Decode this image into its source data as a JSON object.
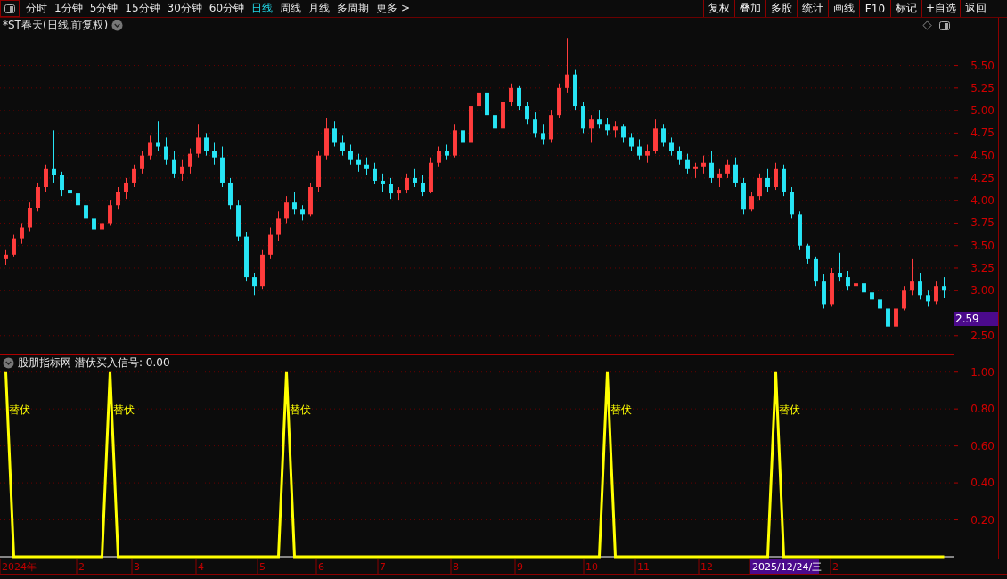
{
  "toolbar": {
    "periods": [
      {
        "label": "分时",
        "selected": false
      },
      {
        "label": "1分钟",
        "selected": false
      },
      {
        "label": "5分钟",
        "selected": false
      },
      {
        "label": "15分钟",
        "selected": false
      },
      {
        "label": "30分钟",
        "selected": false
      },
      {
        "label": "60分钟",
        "selected": false
      },
      {
        "label": "日线",
        "selected": true
      },
      {
        "label": "周线",
        "selected": false
      },
      {
        "label": "月线",
        "selected": false
      },
      {
        "label": "多周期",
        "selected": false
      },
      {
        "label": "更多 >",
        "selected": false
      }
    ],
    "buttons": [
      "复权",
      "叠加",
      "多股",
      "统计",
      "画线",
      "F10",
      "标记",
      "+自选",
      "返回"
    ]
  },
  "price_panel": {
    "title": "*ST春天(日线.前复权)",
    "current_price": "2.59",
    "chart_data": {
      "type": "candlestick",
      "ylim": [
        2.3,
        6.03
      ],
      "grid": true,
      "yticks": [
        {
          "value": 5.5,
          "label": "5.50"
        },
        {
          "value": 5.25,
          "label": "5.25"
        },
        {
          "value": 5,
          "label": "5.00"
        },
        {
          "value": 4.75,
          "label": "4.75"
        },
        {
          "value": 4.5,
          "label": "4.50"
        },
        {
          "value": 4.25,
          "label": "4.25"
        },
        {
          "value": 4,
          "label": "4.00"
        },
        {
          "value": 3.75,
          "label": "3.75"
        },
        {
          "value": 3.5,
          "label": "3.50"
        },
        {
          "value": 3.25,
          "label": "3.25"
        },
        {
          "value": 3,
          "label": "3.00"
        },
        {
          "value": 2.5,
          "label": "2.50"
        }
      ],
      "categories": [
        null,
        null,
        null,
        null,
        null,
        null,
        null,
        null,
        null,
        null,
        null,
        null,
        null,
        null,
        null,
        null,
        null,
        null,
        null,
        null,
        null,
        null,
        null,
        null,
        null,
        null,
        null,
        null,
        null,
        null,
        null,
        null,
        null,
        null,
        null,
        null,
        null,
        null,
        null,
        null,
        null,
        null,
        null,
        null,
        null,
        null,
        null,
        null,
        null,
        null,
        null,
        null,
        null,
        null,
        null,
        null,
        null,
        null,
        null,
        null,
        null,
        null,
        null,
        null,
        null,
        null,
        null,
        null,
        null,
        null,
        null,
        null,
        null,
        null,
        null,
        null,
        null,
        null,
        null,
        null,
        null,
        null,
        null,
        null,
        null,
        null,
        null,
        null,
        null,
        null,
        null,
        null,
        null,
        null,
        null,
        null,
        null,
        null,
        null,
        null,
        null,
        null,
        null,
        null,
        null,
        null,
        null,
        null,
        null,
        null,
        null,
        null,
        null,
        null,
        null,
        null,
        null,
        null
      ],
      "ohlc": [
        [
          3.35,
          3.45,
          3.28,
          3.4
        ],
        [
          3.4,
          3.62,
          3.38,
          3.58
        ],
        [
          3.58,
          3.75,
          3.52,
          3.7
        ],
        [
          3.7,
          3.98,
          3.66,
          3.92
        ],
        [
          3.92,
          4.2,
          3.88,
          4.15
        ],
        [
          4.15,
          4.4,
          4.1,
          4.35
        ],
        [
          4.35,
          4.78,
          4.2,
          4.28
        ],
        [
          4.28,
          4.32,
          4.05,
          4.12
        ],
        [
          4.12,
          4.2,
          4.0,
          4.08
        ],
        [
          4.08,
          4.15,
          3.9,
          3.95
        ],
        [
          3.95,
          4.0,
          3.75,
          3.8
        ],
        [
          3.8,
          3.85,
          3.62,
          3.68
        ],
        [
          3.68,
          3.8,
          3.6,
          3.75
        ],
        [
          3.75,
          4.0,
          3.72,
          3.95
        ],
        [
          3.95,
          4.15,
          3.9,
          4.1
        ],
        [
          4.1,
          4.25,
          4.02,
          4.2
        ],
        [
          4.2,
          4.4,
          4.15,
          4.35
        ],
        [
          4.35,
          4.55,
          4.3,
          4.5
        ],
        [
          4.5,
          4.72,
          4.45,
          4.65
        ],
        [
          4.65,
          4.88,
          4.55,
          4.6
        ],
        [
          4.6,
          4.7,
          4.4,
          4.45
        ],
        [
          4.45,
          4.55,
          4.25,
          4.3
        ],
        [
          4.3,
          4.45,
          4.22,
          4.38
        ],
        [
          4.38,
          4.58,
          4.3,
          4.52
        ],
        [
          4.52,
          4.85,
          4.48,
          4.7
        ],
        [
          4.7,
          4.75,
          4.5,
          4.55
        ],
        [
          4.55,
          4.65,
          4.4,
          4.48
        ],
        [
          4.48,
          4.6,
          4.15,
          4.2
        ],
        [
          4.2,
          4.25,
          3.9,
          3.95
        ],
        [
          3.95,
          4.0,
          3.55,
          3.6
        ],
        [
          3.6,
          3.65,
          3.1,
          3.15
        ],
        [
          3.15,
          3.2,
          2.95,
          3.05
        ],
        [
          3.05,
          3.45,
          3.02,
          3.4
        ],
        [
          3.4,
          3.7,
          3.35,
          3.62
        ],
        [
          3.62,
          3.88,
          3.55,
          3.8
        ],
        [
          3.8,
          4.05,
          3.75,
          3.98
        ],
        [
          3.98,
          4.1,
          3.85,
          3.9
        ],
        [
          3.9,
          3.95,
          3.78,
          3.85
        ],
        [
          3.85,
          4.2,
          3.82,
          4.15
        ],
        [
          4.15,
          4.55,
          4.1,
          4.5
        ],
        [
          4.5,
          4.92,
          4.45,
          4.8
        ],
        [
          4.8,
          4.88,
          4.6,
          4.65
        ],
        [
          4.65,
          4.72,
          4.5,
          4.55
        ],
        [
          4.55,
          4.62,
          4.4,
          4.45
        ],
        [
          4.45,
          4.52,
          4.32,
          4.4
        ],
        [
          4.4,
          4.48,
          4.28,
          4.35
        ],
        [
          4.35,
          4.42,
          4.18,
          4.22
        ],
        [
          4.22,
          4.3,
          4.1,
          4.18
        ],
        [
          4.18,
          4.25,
          4.02,
          4.08
        ],
        [
          4.08,
          4.15,
          4.0,
          4.12
        ],
        [
          4.12,
          4.3,
          4.08,
          4.25
        ],
        [
          4.25,
          4.35,
          4.15,
          4.2
        ],
        [
          4.2,
          4.28,
          4.05,
          4.1
        ],
        [
          4.1,
          4.48,
          4.08,
          4.42
        ],
        [
          4.42,
          4.6,
          4.38,
          4.55
        ],
        [
          4.55,
          4.62,
          4.45,
          4.5
        ],
        [
          4.5,
          4.85,
          4.48,
          4.78
        ],
        [
          4.78,
          4.9,
          4.6,
          4.65
        ],
        [
          4.65,
          5.1,
          4.62,
          5.05
        ],
        [
          5.05,
          5.55,
          5.0,
          5.2
        ],
        [
          5.2,
          5.25,
          4.9,
          4.95
        ],
        [
          4.95,
          5.05,
          4.75,
          4.8
        ],
        [
          4.8,
          5.15,
          4.78,
          5.1
        ],
        [
          5.1,
          5.3,
          5.05,
          5.25
        ],
        [
          5.25,
          5.28,
          5.0,
          5.05
        ],
        [
          5.05,
          5.1,
          4.85,
          4.9
        ],
        [
          4.9,
          4.98,
          4.7,
          4.75
        ],
        [
          4.75,
          4.85,
          4.62,
          4.68
        ],
        [
          4.68,
          5.0,
          4.65,
          4.95
        ],
        [
          4.95,
          5.3,
          4.92,
          5.25
        ],
        [
          5.25,
          5.8,
          5.2,
          5.4
        ],
        [
          5.4,
          5.45,
          5.0,
          5.05
        ],
        [
          5.05,
          5.1,
          4.75,
          4.8
        ],
        [
          4.8,
          4.95,
          4.65,
          4.9
        ],
        [
          4.9,
          5.0,
          4.8,
          4.85
        ],
        [
          4.85,
          4.92,
          4.72,
          4.78
        ],
        [
          4.78,
          4.88,
          4.7,
          4.82
        ],
        [
          4.82,
          4.85,
          4.65,
          4.7
        ],
        [
          4.7,
          4.75,
          4.55,
          4.6
        ],
        [
          4.6,
          4.68,
          4.45,
          4.5
        ],
        [
          4.5,
          4.62,
          4.42,
          4.55
        ],
        [
          4.55,
          4.9,
          4.52,
          4.8
        ],
        [
          4.8,
          4.85,
          4.6,
          4.65
        ],
        [
          4.65,
          4.7,
          4.5,
          4.55
        ],
        [
          4.55,
          4.6,
          4.4,
          4.45
        ],
        [
          4.45,
          4.52,
          4.3,
          4.35
        ],
        [
          4.35,
          4.42,
          4.25,
          4.38
        ],
        [
          4.38,
          4.5,
          4.3,
          4.42
        ],
        [
          4.42,
          4.55,
          4.2,
          4.25
        ],
        [
          4.25,
          4.35,
          4.15,
          4.3
        ],
        [
          4.3,
          4.45,
          4.25,
          4.4
        ],
        [
          4.4,
          4.48,
          4.15,
          4.2
        ],
        [
          4.2,
          4.25,
          3.85,
          3.9
        ],
        [
          3.9,
          4.1,
          3.88,
          4.05
        ],
        [
          4.05,
          4.3,
          4.0,
          4.25
        ],
        [
          4.25,
          4.35,
          4.1,
          4.15
        ],
        [
          4.15,
          4.42,
          4.12,
          4.35
        ],
        [
          4.35,
          4.4,
          4.05,
          4.1
        ],
        [
          4.1,
          4.15,
          3.8,
          3.85
        ],
        [
          3.85,
          3.88,
          3.45,
          3.5
        ],
        [
          3.5,
          3.52,
          3.3,
          3.35
        ],
        [
          3.35,
          3.38,
          3.05,
          3.1
        ],
        [
          3.1,
          3.18,
          2.8,
          2.85
        ],
        [
          2.85,
          3.25,
          2.82,
          3.2
        ],
        [
          3.2,
          3.42,
          3.1,
          3.15
        ],
        [
          3.15,
          3.22,
          3.0,
          3.05
        ],
        [
          3.05,
          3.12,
          2.95,
          3.08
        ],
        [
          3.08,
          3.15,
          2.92,
          2.98
        ],
        [
          2.98,
          3.05,
          2.85,
          2.9
        ],
        [
          2.9,
          2.95,
          2.75,
          2.8
        ],
        [
          2.8,
          2.85,
          2.53,
          2.6
        ],
        [
          2.6,
          2.85,
          2.58,
          2.8
        ],
        [
          2.8,
          3.05,
          2.78,
          3.0
        ],
        [
          3.0,
          3.35,
          2.95,
          3.1
        ],
        [
          3.1,
          3.2,
          2.9,
          2.95
        ],
        [
          2.95,
          3.0,
          2.82,
          2.88
        ],
        [
          2.88,
          3.1,
          2.85,
          3.05
        ],
        [
          3.05,
          3.15,
          2.92,
          3.0
        ]
      ]
    }
  },
  "indicator_panel": {
    "source": "股朋指标网",
    "reading": ": 0.00",
    "signal_labels": [
      "替伏",
      "替伏",
      "替伏",
      "替伏",
      "替伏"
    ],
    "chart_data": {
      "type": "line",
      "ylim": [
        0,
        1.1
      ],
      "grid": true,
      "yticks": [
        {
          "value": 1,
          "label": "1.00"
        },
        {
          "value": 0.8,
          "label": "0.80"
        },
        {
          "value": 0.6,
          "label": "0.60"
        },
        {
          "value": 0.4,
          "label": "0.40"
        },
        {
          "value": 0.2,
          "label": "0.20"
        }
      ],
      "categories": [
        null,
        null,
        null,
        null,
        null,
        null,
        null,
        null,
        null,
        null,
        null,
        null,
        null,
        null,
        null,
        null,
        null,
        null,
        null,
        null,
        null,
        null,
        null,
        null,
        null,
        null,
        null,
        null,
        null,
        null,
        null,
        null,
        null,
        null,
        null,
        null,
        null,
        null,
        null,
        null,
        null,
        null,
        null,
        null,
        null,
        null,
        null,
        null,
        null,
        null,
        null,
        null,
        null,
        null,
        null,
        null,
        null,
        null,
        null,
        null,
        null,
        null,
        null,
        null,
        null,
        null,
        null,
        null,
        null,
        null,
        null,
        null,
        null,
        null,
        null,
        null,
        null,
        null,
        null,
        null,
        null,
        null,
        null,
        null,
        null,
        null,
        null,
        null,
        null,
        null,
        null,
        null,
        null,
        null,
        null,
        null,
        null,
        null,
        null,
        null,
        null,
        null,
        null,
        null,
        null,
        null,
        null,
        null,
        null,
        null,
        null,
        null,
        null,
        null,
        null,
        null,
        null,
        null
      ],
      "series": [
        {
          "name": "潜伏买入信号",
          "color": "#ffff00",
          "values": [
            1,
            0,
            0,
            0,
            0,
            0,
            0,
            0,
            0,
            0,
            0,
            0,
            0,
            1,
            0,
            0,
            0,
            0,
            0,
            0,
            0,
            0,
            0,
            0,
            0,
            0,
            0,
            0,
            0,
            0,
            0,
            0,
            0,
            0,
            0,
            1,
            0,
            0,
            0,
            0,
            0,
            0,
            0,
            0,
            0,
            0,
            0,
            0,
            0,
            0,
            0,
            0,
            0,
            0,
            0,
            0,
            0,
            0,
            0,
            0,
            0,
            0,
            0,
            0,
            0,
            0,
            0,
            0,
            0,
            0,
            0,
            0,
            0,
            0,
            0,
            1,
            0,
            0,
            0,
            0,
            0,
            0,
            0,
            0,
            0,
            0,
            0,
            0,
            0,
            0,
            0,
            0,
            0,
            0,
            0,
            0,
            1,
            0,
            0,
            0,
            0,
            0,
            0,
            0,
            0,
            0,
            0,
            0,
            0,
            0,
            0,
            0,
            0,
            0,
            0,
            0,
            0,
            0
          ]
        }
      ]
    }
  },
  "date_axis": {
    "labels": [
      {
        "text": "2024年",
        "selected": false
      },
      {
        "text": "2",
        "selected": false
      },
      {
        "text": "3",
        "selected": false
      },
      {
        "text": "4",
        "selected": false
      },
      {
        "text": "5",
        "selected": false
      },
      {
        "text": "6",
        "selected": false
      },
      {
        "text": "7",
        "selected": false
      },
      {
        "text": "8",
        "selected": false
      },
      {
        "text": "9",
        "selected": false
      },
      {
        "text": "10",
        "selected": false
      },
      {
        "text": "11",
        "selected": false
      },
      {
        "text": "12",
        "selected": false
      },
      {
        "text": "2025/12/24/三",
        "selected": true
      },
      {
        "text": "2",
        "selected": false
      }
    ]
  }
}
